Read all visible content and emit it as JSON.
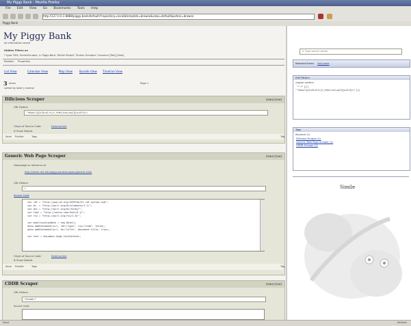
{
  "browser": {
    "title": "My Piggy Bank - Mozilla Firefox",
    "menu": [
      "File",
      "Edit",
      "View",
      "Go",
      "Bookmarks",
      "Tools",
      "Help"
    ],
    "url": "http://127.0.0.1:8888/piggy-bank/default/?repository=local&template=browse&view=default&action=browse",
    "bookmark": "Piggy Bank"
  },
  "page": {
    "title": "My Piggy Bank",
    "subtitle": "all information saved",
    "filter_label": "Hidden Filters on",
    "filter_text": "* type: RSS; ScreenScraper, in Piggy-Bank 'Simile Project' 'Screen Scrapers' Common [Tab] [View]",
    "tabs": [
      "Relation",
      "Properties"
    ],
    "views": [
      "List View",
      "Calendar View",
      "Map View",
      "Bundle View",
      "Timeline View"
    ],
    "results_count": "3",
    "results_label": "items",
    "results_sub": "sorted by label | reverse",
    "page_label": "Page 1"
  },
  "modules": [
    {
      "title": "Dilicious Scraper",
      "controls": "[Edit] [Del]",
      "url_pattern_label": "URL Pattern",
      "url_pattern": "^https?://([A-Za-z0-9-]+\\.)*del\\.icio\\.us/(\\?|[a-z0-9]+)",
      "origin_label": "Origin of Source Code:",
      "origin_link": "External link",
      "actions": [
        "Save",
        "Publish",
        "Tags"
      ],
      "tag_label": "Tag"
    },
    {
      "title": "Generic Web Page Scraper",
      "controls": "[Edit] [Del]",
      "homepage_label": "Homepage or reference of",
      "homepage_link": "http://simile.mit.edu/piggy-bank/scrapers/generic.html",
      "url_pattern_label": "URL Pattern",
      "url_pattern": ".*",
      "source_label": "Source Code",
      "code": "  var rdf = \"http://www.w3.org/1999/02/22-rdf-syntax-ns#\";\n  var dc  = \"http://purl.org/dc/elements/1.1/\";\n  var dct = \"http://purl.org/dc/terms/\";\n  var foaf = \"http://xmlns.com/foaf/0.1/\";\n  var rss = \"http://purl.org/rss/1.0/\";\n\n  var modificationDate = new Date();\n  data.addStatement(url, rdf+\"type\", rss+\"item\", false);\n  data.addStatement(url, dc+\"title\", document.title, true);\n\n  var text = document.body.textContent;",
      "origin_label": "Origin of Source Code:",
      "origin_link": "External link",
      "actions": [
        "Save",
        "Publish",
        "Tags"
      ],
      "tag_label": "Tag"
    },
    {
      "title": "CDDB Scraper",
      "controls": "[Edit] [Del]",
      "url_pattern_label": "URL Pattern",
      "url_pattern": ".*freedb.*",
      "source_label": "Source Code"
    }
  ],
  "sidebar": {
    "search_placeholder": "Type search words",
    "saved_label": "Restored items",
    "saved_value": "Set name",
    "edit_box": {
      "title": "Edit Pattern",
      "lines": [
        "regular pattern",
        "\"^.*\" {1}",
        "\"^https?://([A-Za-z0-9-]+\\.)*del\\.icio\\.us/(\\?|[a-z0-9]+)\" {1}"
      ]
    },
    "tags_box": {
      "title": "Tags",
      "header": "Keyword (1)",
      "items": [
        "Dilicious Scraper (1)",
        "Generic Web Page Scraper (1)",
        "CDDB Scraper (1)"
      ]
    },
    "logo_text": "Simile"
  },
  "status": {
    "left": "Done",
    "right": "Adblock"
  },
  "colors": {
    "page_bg": "#f4f3ef",
    "module_bg": "#e6e6d8",
    "title_color": "#1e2a55",
    "link_color": "#1c3fa5"
  }
}
